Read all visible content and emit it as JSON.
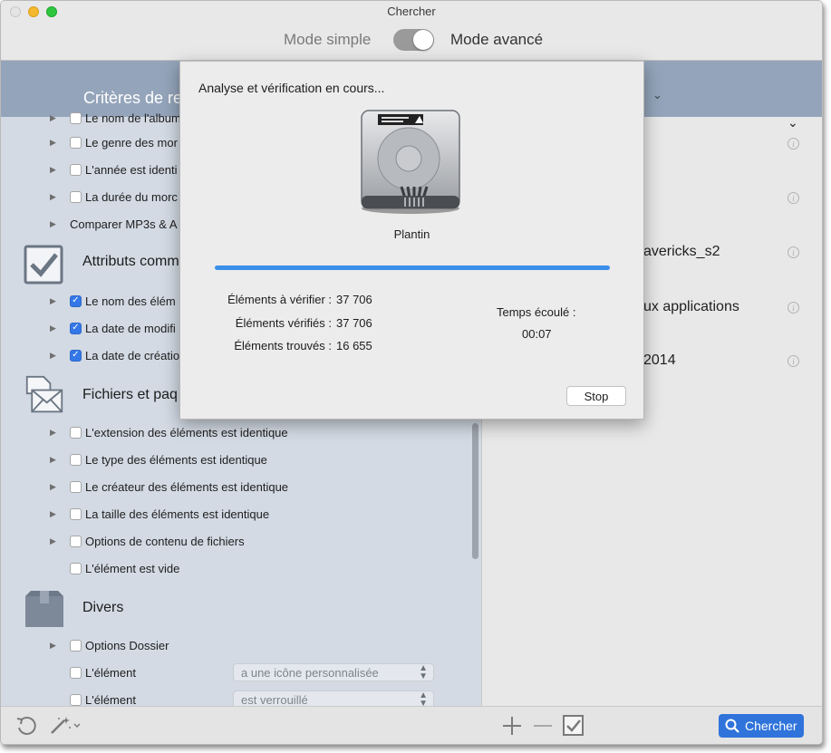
{
  "window": {
    "title": "Chercher",
    "mode_simple": "Mode simple",
    "mode_advanced": "Mode avancé"
  },
  "left": {
    "header_title": "Critères de re",
    "rows_top": [
      {
        "label": "Le nom de l'album",
        "checked": false,
        "disclosure": true
      },
      {
        "label": "Le genre des mor",
        "checked": false,
        "disclosure": true
      },
      {
        "label": "L'année est identi",
        "checked": false,
        "disclosure": true
      },
      {
        "label": "La durée du morc",
        "checked": false,
        "disclosure": true
      },
      {
        "label": "Comparer MP3s & A",
        "checkbox": false,
        "disclosure": true
      }
    ],
    "section_attributes": {
      "title": "Attributs comm",
      "rows": [
        {
          "label": "Le nom des élém",
          "checked": true
        },
        {
          "label": "La date de modifi",
          "checked": true
        },
        {
          "label": "La date de créatio",
          "checked": true
        }
      ]
    },
    "section_files": {
      "title": "Fichiers et paq",
      "rows": [
        {
          "label": "L'extension des éléments est identique",
          "checked": false,
          "disclosure": true
        },
        {
          "label": "Le type des éléments est identique",
          "checked": false,
          "disclosure": true
        },
        {
          "label": "Le créateur des éléments est identique",
          "checked": false,
          "disclosure": true
        },
        {
          "label": "La taille des  éléments est identique",
          "checked": false,
          "disclosure": true
        },
        {
          "label": "Options de contenu de fichiers",
          "checked": false,
          "disclosure": true
        },
        {
          "label": "L'élément est vide",
          "checked": false,
          "disclosure": false
        }
      ]
    },
    "section_misc": {
      "title": "Divers",
      "rows": [
        {
          "label": "Options Dossier",
          "checked": false,
          "disclosure": true
        },
        {
          "label": "L'élément",
          "checked": false,
          "disclosure": false,
          "select": "a une icône personnalisée"
        },
        {
          "label": "L'élément",
          "checked": false,
          "disclosure": false,
          "select": "est verrouillé"
        }
      ]
    }
  },
  "right": {
    "items": [
      {
        "label": ""
      },
      {
        "label": ""
      },
      {
        "label": "avericks_s2"
      },
      {
        "label": "ux applications"
      },
      {
        "label": "2014"
      }
    ]
  },
  "dialog": {
    "title": "Analyse et vérification en cours...",
    "disk_name": "Plantin",
    "progress_percent": 100,
    "stats": [
      {
        "label": "Éléments à vérifier :",
        "value": "37 706"
      },
      {
        "label": "Éléments vérifiés :",
        "value": "37 706"
      },
      {
        "label": "Éléments trouvés :",
        "value": "16 655"
      }
    ],
    "elapsed_label": "Temps écoulé :",
    "elapsed_value": "00:07",
    "stop_label": "Stop"
  },
  "bottom": {
    "search_label": "Chercher"
  },
  "colors": {
    "accent": "#3478e8",
    "header": "#94a4ba",
    "left_panel": "#d3dae4"
  }
}
